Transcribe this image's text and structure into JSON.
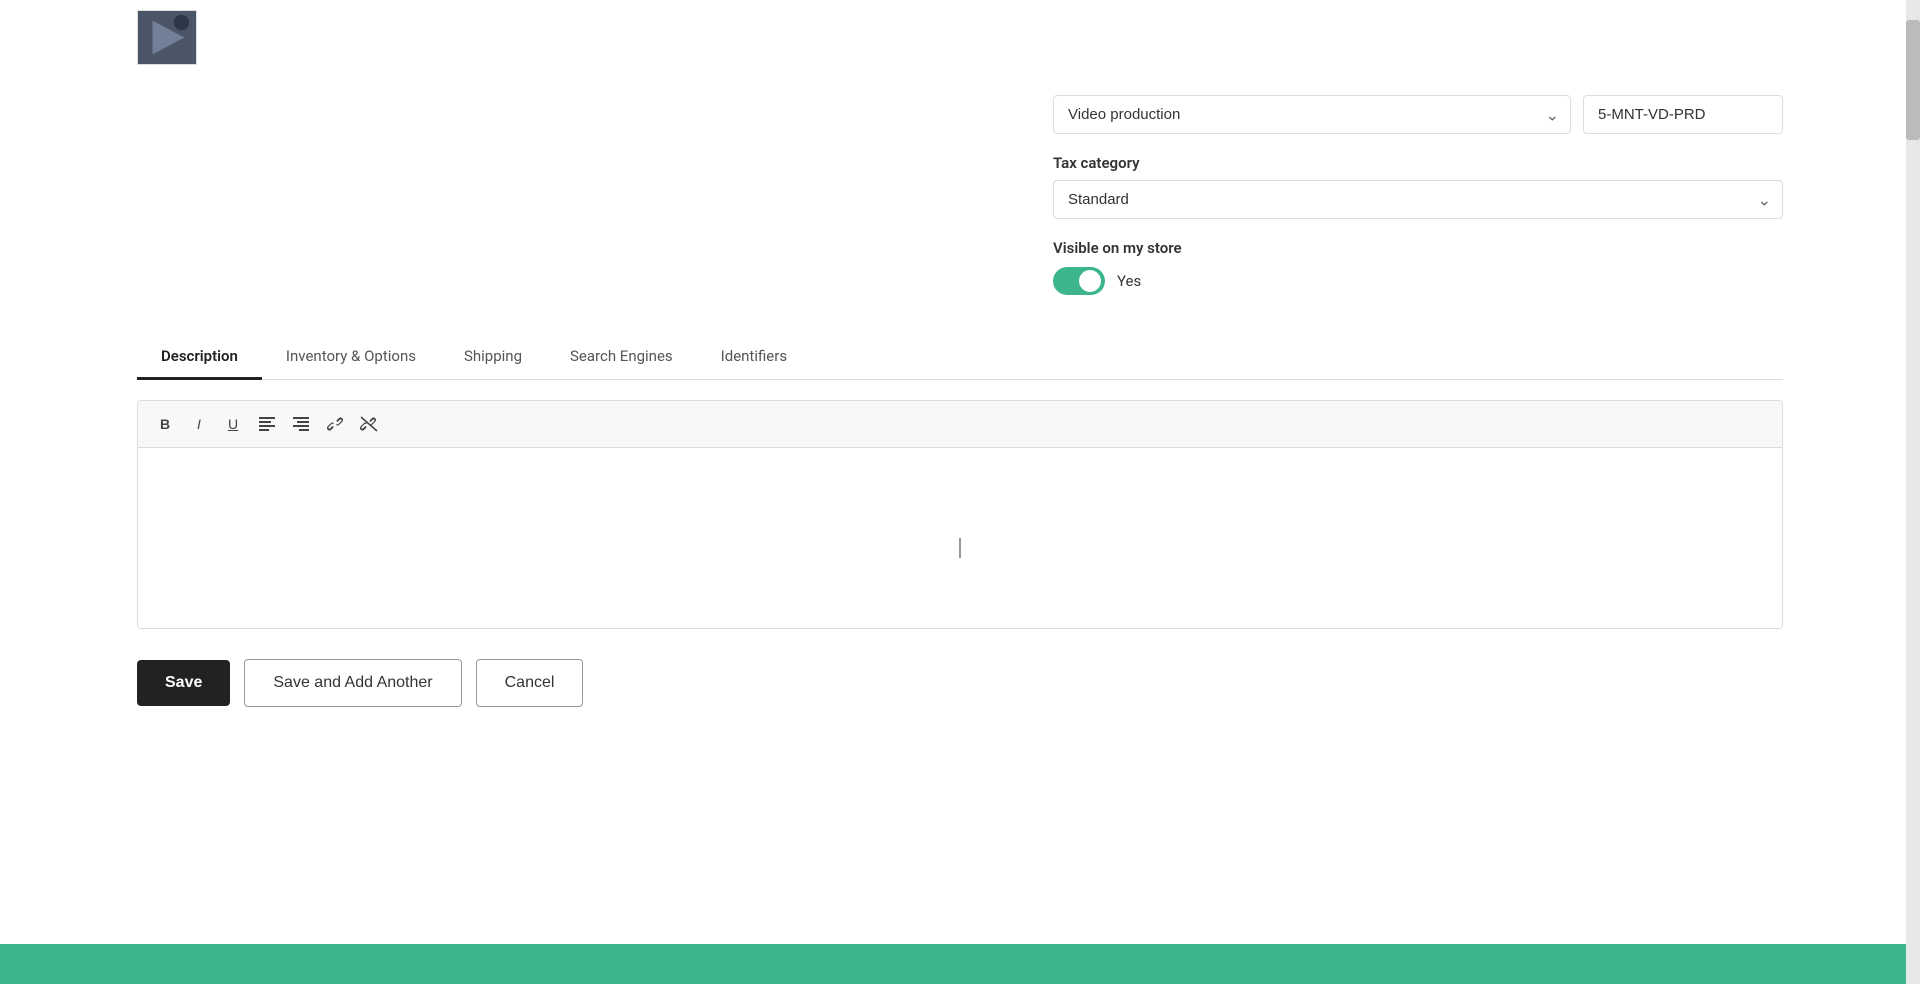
{
  "top": {
    "category_value": "Video production",
    "sku_value": "5-MNT-VD-PRD",
    "tax_label": "Tax category",
    "tax_value": "Standard",
    "visible_label": "Visible on my store",
    "visible_toggle": true,
    "visible_text": "Yes"
  },
  "tabs": {
    "items": [
      {
        "id": "description",
        "label": "Description",
        "active": true
      },
      {
        "id": "inventory",
        "label": "Inventory & Options",
        "active": false
      },
      {
        "id": "shipping",
        "label": "Shipping",
        "active": false
      },
      {
        "id": "search-engines",
        "label": "Search Engines",
        "active": false
      },
      {
        "id": "identifiers",
        "label": "Identifiers",
        "active": false
      }
    ]
  },
  "editor": {
    "toolbar": {
      "bold": "B",
      "italic": "I",
      "underline": "U",
      "align_left": "≡",
      "align_right": "≡",
      "link": "⛓",
      "unlink": "⛓"
    }
  },
  "buttons": {
    "save": "Save",
    "save_add": "Save and Add Another",
    "cancel": "Cancel"
  }
}
